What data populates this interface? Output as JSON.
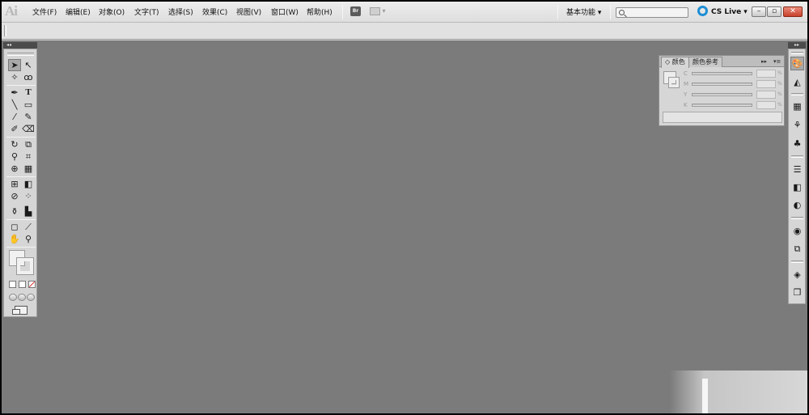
{
  "app": {
    "logo": "Ai",
    "menus": [
      "文件(F)",
      "编辑(E)",
      "对象(O)",
      "文字(T)",
      "选择(S)",
      "效果(C)",
      "视图(V)",
      "窗口(W)",
      "帮助(H)"
    ],
    "bridge_button": "Br",
    "workspace": "基本功能 ▾",
    "search": {
      "value": "",
      "placeholder": ""
    },
    "cs_live": "CS Live ▾",
    "window_controls": {
      "minimize": "–",
      "restore": "▫",
      "close": "✕"
    }
  },
  "panels": {
    "tools_header": "◂◂",
    "dock_header": "▸▸",
    "color": {
      "tabs": [
        "颜色",
        "颜色参考"
      ],
      "tab_icon": "◇",
      "collapse": "▸▸",
      "menu": "▾≡",
      "channels": [
        {
          "label": "C",
          "value": "",
          "unit": "%"
        },
        {
          "label": "M",
          "value": "",
          "unit": "%"
        },
        {
          "label": "Y",
          "value": "",
          "unit": "%"
        },
        {
          "label": "K",
          "value": "",
          "unit": "%"
        }
      ]
    }
  },
  "icons": {
    "tools": [
      "selection-icon",
      "direct-selection-icon",
      "magic-wand-icon",
      "lasso-icon",
      "pen-icon",
      "type-icon",
      "line-segment-icon",
      "rectangle-icon",
      "paintbrush-icon",
      "pencil-icon",
      "blob-brush-icon",
      "eraser-icon",
      "rotate-icon",
      "scale-icon",
      "width-icon",
      "free-transform-icon",
      "shape-builder-icon",
      "perspective-grid-icon",
      "mesh-icon",
      "gradient-icon",
      "eyedropper-icon",
      "blend-icon",
      "symbol-sprayer-icon",
      "column-graph-icon",
      "artboard-icon",
      "slice-icon",
      "hand-icon",
      "zoom-icon"
    ],
    "dock": [
      "color-icon",
      "color-guide-icon",
      "swatches-icon",
      "brushes-icon",
      "symbols-icon",
      "stroke-icon",
      "gradient-panel-icon",
      "transparency-icon",
      "appearance-icon",
      "graphic-styles-icon",
      "layers-icon",
      "artboards-icon"
    ]
  },
  "colors": {
    "canvas": "#7b7b7b",
    "chrome": "#d4d4d4",
    "cs_live_ring": "#1d8fd5",
    "none_swatch_line": "#d02020"
  }
}
